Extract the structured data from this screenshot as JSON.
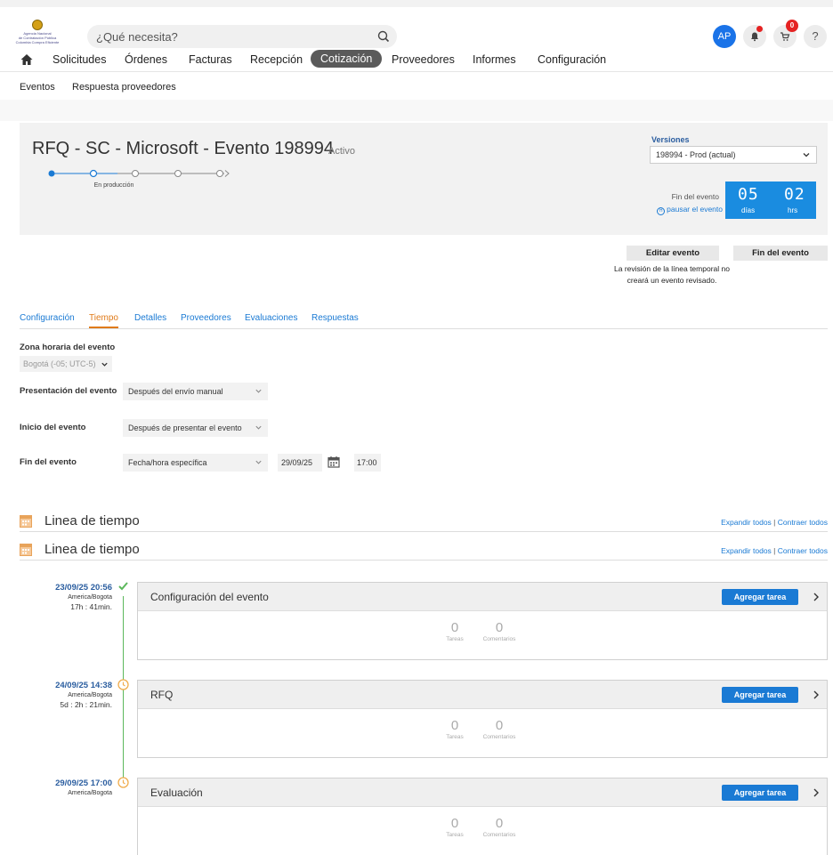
{
  "logo": {
    "line1": "Agencia Nacional",
    "line2": "de Contratación Pública",
    "line3": "Colombia Compra Eficiente"
  },
  "search": {
    "placeholder": "¿Qué necesita?"
  },
  "user": {
    "initials": "AP",
    "cart_count": "0",
    "help": "?"
  },
  "nav": {
    "items": [
      "Solicitudes",
      "Órdenes",
      "Facturas",
      "Recepción",
      "Cotización",
      "Proveedores",
      "Informes",
      "Configuración"
    ],
    "active": "Cotización"
  },
  "subnav": {
    "items": [
      "Eventos",
      "Respuesta proveedores"
    ]
  },
  "event": {
    "title": "RFQ - SC - Microsoft - Evento 198994",
    "status": "Activo",
    "step_label": "En producción",
    "versions_label": "Versiones",
    "version_selected": "198994 - Prod (actual)",
    "end_label": "Fin del evento",
    "pause_link": "pausar el evento",
    "pause_icon": "H",
    "countdown": {
      "days": "05",
      "days_unit": "días",
      "hours": "02",
      "hours_unit": "hrs"
    },
    "edit_button": "Editar evento",
    "end_button": "Fin del evento",
    "edit_note": "La revisión de la línea temporal no creará un evento revisado."
  },
  "tabs": {
    "items": [
      "Configuración",
      "Tiempo",
      "Detalles",
      "Proveedores",
      "Evaluaciones",
      "Respuestas"
    ],
    "active": "Tiempo"
  },
  "form": {
    "timezone_label": "Zona horaria del evento",
    "timezone_value": "Bogotá (-05; UTC-5)",
    "presentation_label": "Presentación del evento",
    "presentation_value": "Después del envío manual",
    "start_label": "Inicio del evento",
    "start_value": "Después de presentar el evento",
    "end_label": "Fin del evento",
    "end_value": "Fecha/hora específica",
    "end_date": "29/09/25",
    "end_time": "17:00"
  },
  "timeline": {
    "title": "Linea de tiempo",
    "expand": "Expandir todos",
    "sep": "|",
    "collapse": "Contraer todos",
    "phases": [
      {
        "date": "23/09/25 20:56",
        "tz": "America/Bogota",
        "duration": "17h : 41min.",
        "title": "Configuración del evento",
        "add": "Agregar tarea",
        "tasks": "0",
        "tasks_label": "Tareas",
        "comments": "0",
        "comments_label": "Comentarios"
      },
      {
        "date": "24/09/25 14:38",
        "tz": "America/Bogota",
        "duration": "5d : 2h : 21min.",
        "title": "RFQ",
        "add": "Agregar tarea",
        "tasks": "0",
        "tasks_label": "Tareas",
        "comments": "0",
        "comments_label": "Comentarios"
      },
      {
        "date": "29/09/25 17:00",
        "tz": "America/Bogota",
        "duration": "",
        "title": "Evaluación",
        "add": "Agregar tarea",
        "tasks": "0",
        "tasks_label": "Tareas",
        "comments": "0",
        "comments_label": "Comentarios"
      }
    ]
  },
  "colors": {
    "accent": "#1a7ad4",
    "active_tab": "#e07b1a",
    "countdown": "#1a8ce0",
    "done": "#5cb85c",
    "pending": "#f0ad4e"
  }
}
